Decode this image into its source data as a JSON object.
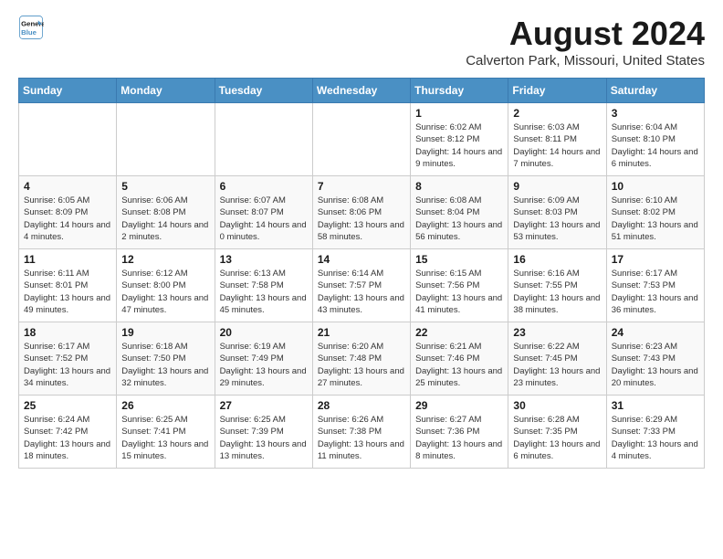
{
  "header": {
    "logo_line1": "General",
    "logo_line2": "Blue",
    "title": "August 2024",
    "subtitle": "Calverton Park, Missouri, United States"
  },
  "days_of_week": [
    "Sunday",
    "Monday",
    "Tuesday",
    "Wednesday",
    "Thursday",
    "Friday",
    "Saturday"
  ],
  "weeks": [
    [
      {
        "day": "",
        "info": ""
      },
      {
        "day": "",
        "info": ""
      },
      {
        "day": "",
        "info": ""
      },
      {
        "day": "",
        "info": ""
      },
      {
        "day": "1",
        "info": "Sunrise: 6:02 AM\nSunset: 8:12 PM\nDaylight: 14 hours and 9 minutes."
      },
      {
        "day": "2",
        "info": "Sunrise: 6:03 AM\nSunset: 8:11 PM\nDaylight: 14 hours and 7 minutes."
      },
      {
        "day": "3",
        "info": "Sunrise: 6:04 AM\nSunset: 8:10 PM\nDaylight: 14 hours and 6 minutes."
      }
    ],
    [
      {
        "day": "4",
        "info": "Sunrise: 6:05 AM\nSunset: 8:09 PM\nDaylight: 14 hours and 4 minutes."
      },
      {
        "day": "5",
        "info": "Sunrise: 6:06 AM\nSunset: 8:08 PM\nDaylight: 14 hours and 2 minutes."
      },
      {
        "day": "6",
        "info": "Sunrise: 6:07 AM\nSunset: 8:07 PM\nDaylight: 14 hours and 0 minutes."
      },
      {
        "day": "7",
        "info": "Sunrise: 6:08 AM\nSunset: 8:06 PM\nDaylight: 13 hours and 58 minutes."
      },
      {
        "day": "8",
        "info": "Sunrise: 6:08 AM\nSunset: 8:04 PM\nDaylight: 13 hours and 56 minutes."
      },
      {
        "day": "9",
        "info": "Sunrise: 6:09 AM\nSunset: 8:03 PM\nDaylight: 13 hours and 53 minutes."
      },
      {
        "day": "10",
        "info": "Sunrise: 6:10 AM\nSunset: 8:02 PM\nDaylight: 13 hours and 51 minutes."
      }
    ],
    [
      {
        "day": "11",
        "info": "Sunrise: 6:11 AM\nSunset: 8:01 PM\nDaylight: 13 hours and 49 minutes."
      },
      {
        "day": "12",
        "info": "Sunrise: 6:12 AM\nSunset: 8:00 PM\nDaylight: 13 hours and 47 minutes."
      },
      {
        "day": "13",
        "info": "Sunrise: 6:13 AM\nSunset: 7:58 PM\nDaylight: 13 hours and 45 minutes."
      },
      {
        "day": "14",
        "info": "Sunrise: 6:14 AM\nSunset: 7:57 PM\nDaylight: 13 hours and 43 minutes."
      },
      {
        "day": "15",
        "info": "Sunrise: 6:15 AM\nSunset: 7:56 PM\nDaylight: 13 hours and 41 minutes."
      },
      {
        "day": "16",
        "info": "Sunrise: 6:16 AM\nSunset: 7:55 PM\nDaylight: 13 hours and 38 minutes."
      },
      {
        "day": "17",
        "info": "Sunrise: 6:17 AM\nSunset: 7:53 PM\nDaylight: 13 hours and 36 minutes."
      }
    ],
    [
      {
        "day": "18",
        "info": "Sunrise: 6:17 AM\nSunset: 7:52 PM\nDaylight: 13 hours and 34 minutes."
      },
      {
        "day": "19",
        "info": "Sunrise: 6:18 AM\nSunset: 7:50 PM\nDaylight: 13 hours and 32 minutes."
      },
      {
        "day": "20",
        "info": "Sunrise: 6:19 AM\nSunset: 7:49 PM\nDaylight: 13 hours and 29 minutes."
      },
      {
        "day": "21",
        "info": "Sunrise: 6:20 AM\nSunset: 7:48 PM\nDaylight: 13 hours and 27 minutes."
      },
      {
        "day": "22",
        "info": "Sunrise: 6:21 AM\nSunset: 7:46 PM\nDaylight: 13 hours and 25 minutes."
      },
      {
        "day": "23",
        "info": "Sunrise: 6:22 AM\nSunset: 7:45 PM\nDaylight: 13 hours and 23 minutes."
      },
      {
        "day": "24",
        "info": "Sunrise: 6:23 AM\nSunset: 7:43 PM\nDaylight: 13 hours and 20 minutes."
      }
    ],
    [
      {
        "day": "25",
        "info": "Sunrise: 6:24 AM\nSunset: 7:42 PM\nDaylight: 13 hours and 18 minutes."
      },
      {
        "day": "26",
        "info": "Sunrise: 6:25 AM\nSunset: 7:41 PM\nDaylight: 13 hours and 15 minutes."
      },
      {
        "day": "27",
        "info": "Sunrise: 6:25 AM\nSunset: 7:39 PM\nDaylight: 13 hours and 13 minutes."
      },
      {
        "day": "28",
        "info": "Sunrise: 6:26 AM\nSunset: 7:38 PM\nDaylight: 13 hours and 11 minutes."
      },
      {
        "day": "29",
        "info": "Sunrise: 6:27 AM\nSunset: 7:36 PM\nDaylight: 13 hours and 8 minutes."
      },
      {
        "day": "30",
        "info": "Sunrise: 6:28 AM\nSunset: 7:35 PM\nDaylight: 13 hours and 6 minutes."
      },
      {
        "day": "31",
        "info": "Sunrise: 6:29 AM\nSunset: 7:33 PM\nDaylight: 13 hours and 4 minutes."
      }
    ]
  ]
}
